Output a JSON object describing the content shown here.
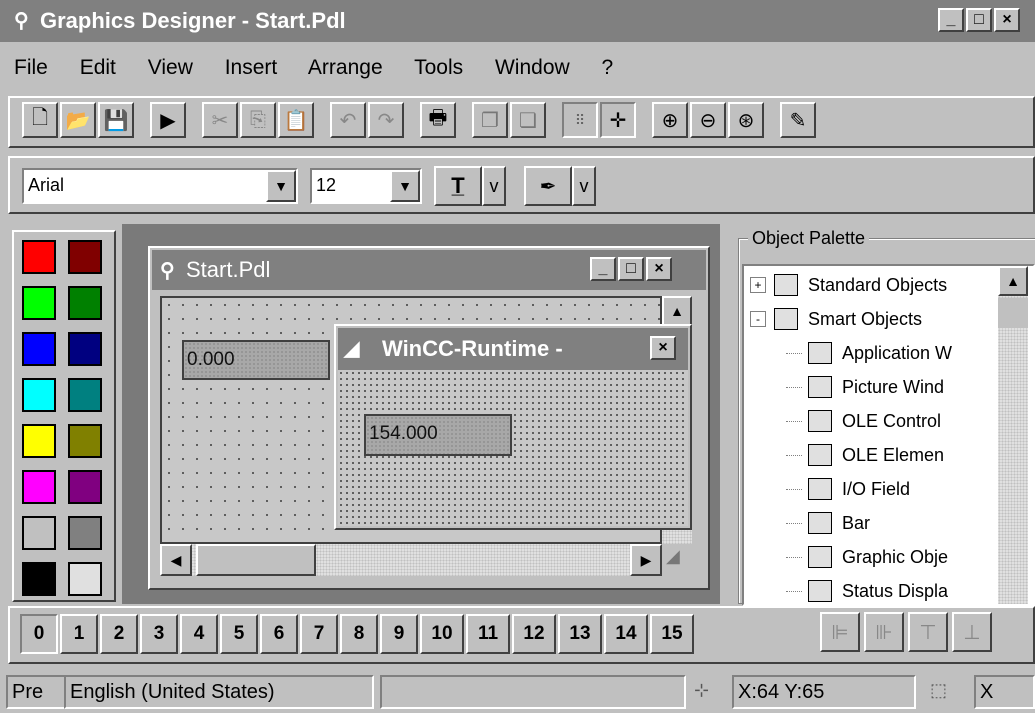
{
  "app": {
    "title": "Graphics Designer - Start.Pdl",
    "title_icon": "compass-icon",
    "window_buttons": [
      "_",
      "□",
      "×"
    ]
  },
  "menu": [
    {
      "label": "File"
    },
    {
      "label": "Edit"
    },
    {
      "label": "View"
    },
    {
      "label": "Insert"
    },
    {
      "label": "Arrange"
    },
    {
      "label": "Tools"
    },
    {
      "label": "Window"
    },
    {
      "label": "?"
    }
  ],
  "toolbar": {
    "icons": [
      "new-document-icon",
      "open-folder-icon",
      "save-icon",
      "run-icon",
      "cut-icon",
      "copy-icon",
      "paste-icon",
      "undo-icon",
      "redo-icon",
      "print-icon",
      "bring-to-front-icon",
      "send-to-back-icon",
      "grid-icon",
      "snap-icon",
      "zoom-in-icon",
      "zoom-out-icon",
      "zoom-area-icon",
      "eyedropper-icon"
    ]
  },
  "format_bar": {
    "font": "Arial",
    "size": "12",
    "toggle_a": "v",
    "toggle_b": "v"
  },
  "palette_colors": [
    [
      "#ff0000",
      "#800000"
    ],
    [
      "#00ff00",
      "#008000"
    ],
    [
      "#0000ff",
      "#000080"
    ],
    [
      "#00ffff",
      "#008080"
    ],
    [
      "#ffff00",
      "#808000"
    ],
    [
      "#ff00ff",
      "#800080"
    ],
    [
      "#c0c0c0",
      "#808080"
    ],
    [
      "#000000",
      "#e0e0e0"
    ]
  ],
  "doc_window": {
    "title": "Start.Pdl",
    "field_value": "0.000"
  },
  "runtime_window": {
    "title": "WinCC-Runtime -",
    "field_value": "154.000"
  },
  "object_palette": {
    "label": "Object Palette",
    "items": [
      {
        "label": "Standard Objects",
        "icon": "standard-objects-icon",
        "level": 0,
        "expander": "+"
      },
      {
        "label": "Smart Objects",
        "icon": "smart-objects-icon",
        "level": 0,
        "expander": "-"
      },
      {
        "label": "Application W",
        "icon": "application-window-icon",
        "level": 1
      },
      {
        "label": "Picture Wind",
        "icon": "picture-window-icon",
        "level": 1
      },
      {
        "label": "OLE Control",
        "icon": "ole-control-icon",
        "level": 1
      },
      {
        "label": "OLE Elemen",
        "icon": "ole-element-icon",
        "level": 1
      },
      {
        "label": "I/O Field",
        "icon": "io-field-icon",
        "level": 1
      },
      {
        "label": "Bar",
        "icon": "bar-icon",
        "level": 1
      },
      {
        "label": "Graphic Obje",
        "icon": "graphic-object-icon",
        "level": 1
      },
      {
        "label": "Status Displa",
        "icon": "status-display-icon",
        "level": 1
      }
    ]
  },
  "layers": [
    "0",
    "1",
    "2",
    "3",
    "4",
    "5",
    "6",
    "7",
    "8",
    "9",
    "10",
    "11",
    "12",
    "13",
    "14",
    "15"
  ],
  "status": {
    "left": "Pre",
    "language": "English (United States)",
    "coords": "X:64 Y:65",
    "extra": "X"
  }
}
